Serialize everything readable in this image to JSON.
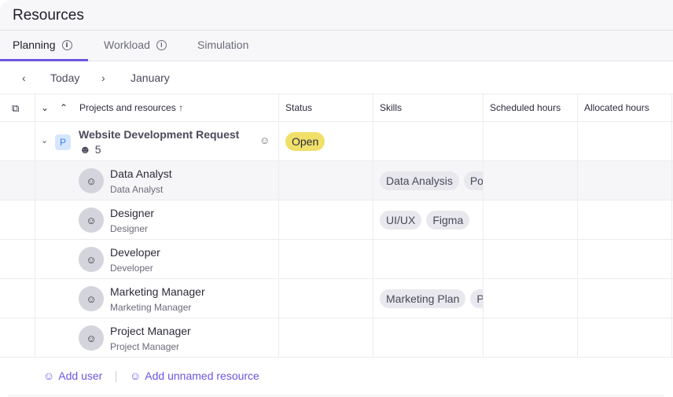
{
  "header": {
    "title": "Resources"
  },
  "tabs": [
    {
      "label": "Planning"
    },
    {
      "label": "Workload"
    },
    {
      "label": "Simulation"
    }
  ],
  "nav": {
    "today": "Today",
    "month": "January"
  },
  "columns": {
    "projects": "Projects and resources",
    "status": "Status",
    "skills": "Skills",
    "scheduled": "Scheduled hours",
    "allocated": "Allocated hours"
  },
  "project": {
    "badge": "P",
    "name": "Website Development Request",
    "count": "5",
    "status": "Open"
  },
  "resources": [
    {
      "name": "Data Analyst",
      "role": "Data Analyst",
      "skills": [
        "Data Analysis",
        "Pow"
      ]
    },
    {
      "name": "Designer",
      "role": "Designer",
      "skills": [
        "UI/UX",
        "Figma"
      ]
    },
    {
      "name": "Developer",
      "role": "Developer",
      "skills": []
    },
    {
      "name": "Marketing Manager",
      "role": "Marketing Manager",
      "skills": [
        "Marketing Plan",
        "Pr"
      ]
    },
    {
      "name": "Project Manager",
      "role": "Project Manager",
      "skills": []
    }
  ],
  "footer": {
    "add_user": "Add user",
    "add_unnamed": "Add unnamed resource"
  },
  "colors": {
    "accent": "#6e55e0",
    "open": "#f0e06a"
  }
}
